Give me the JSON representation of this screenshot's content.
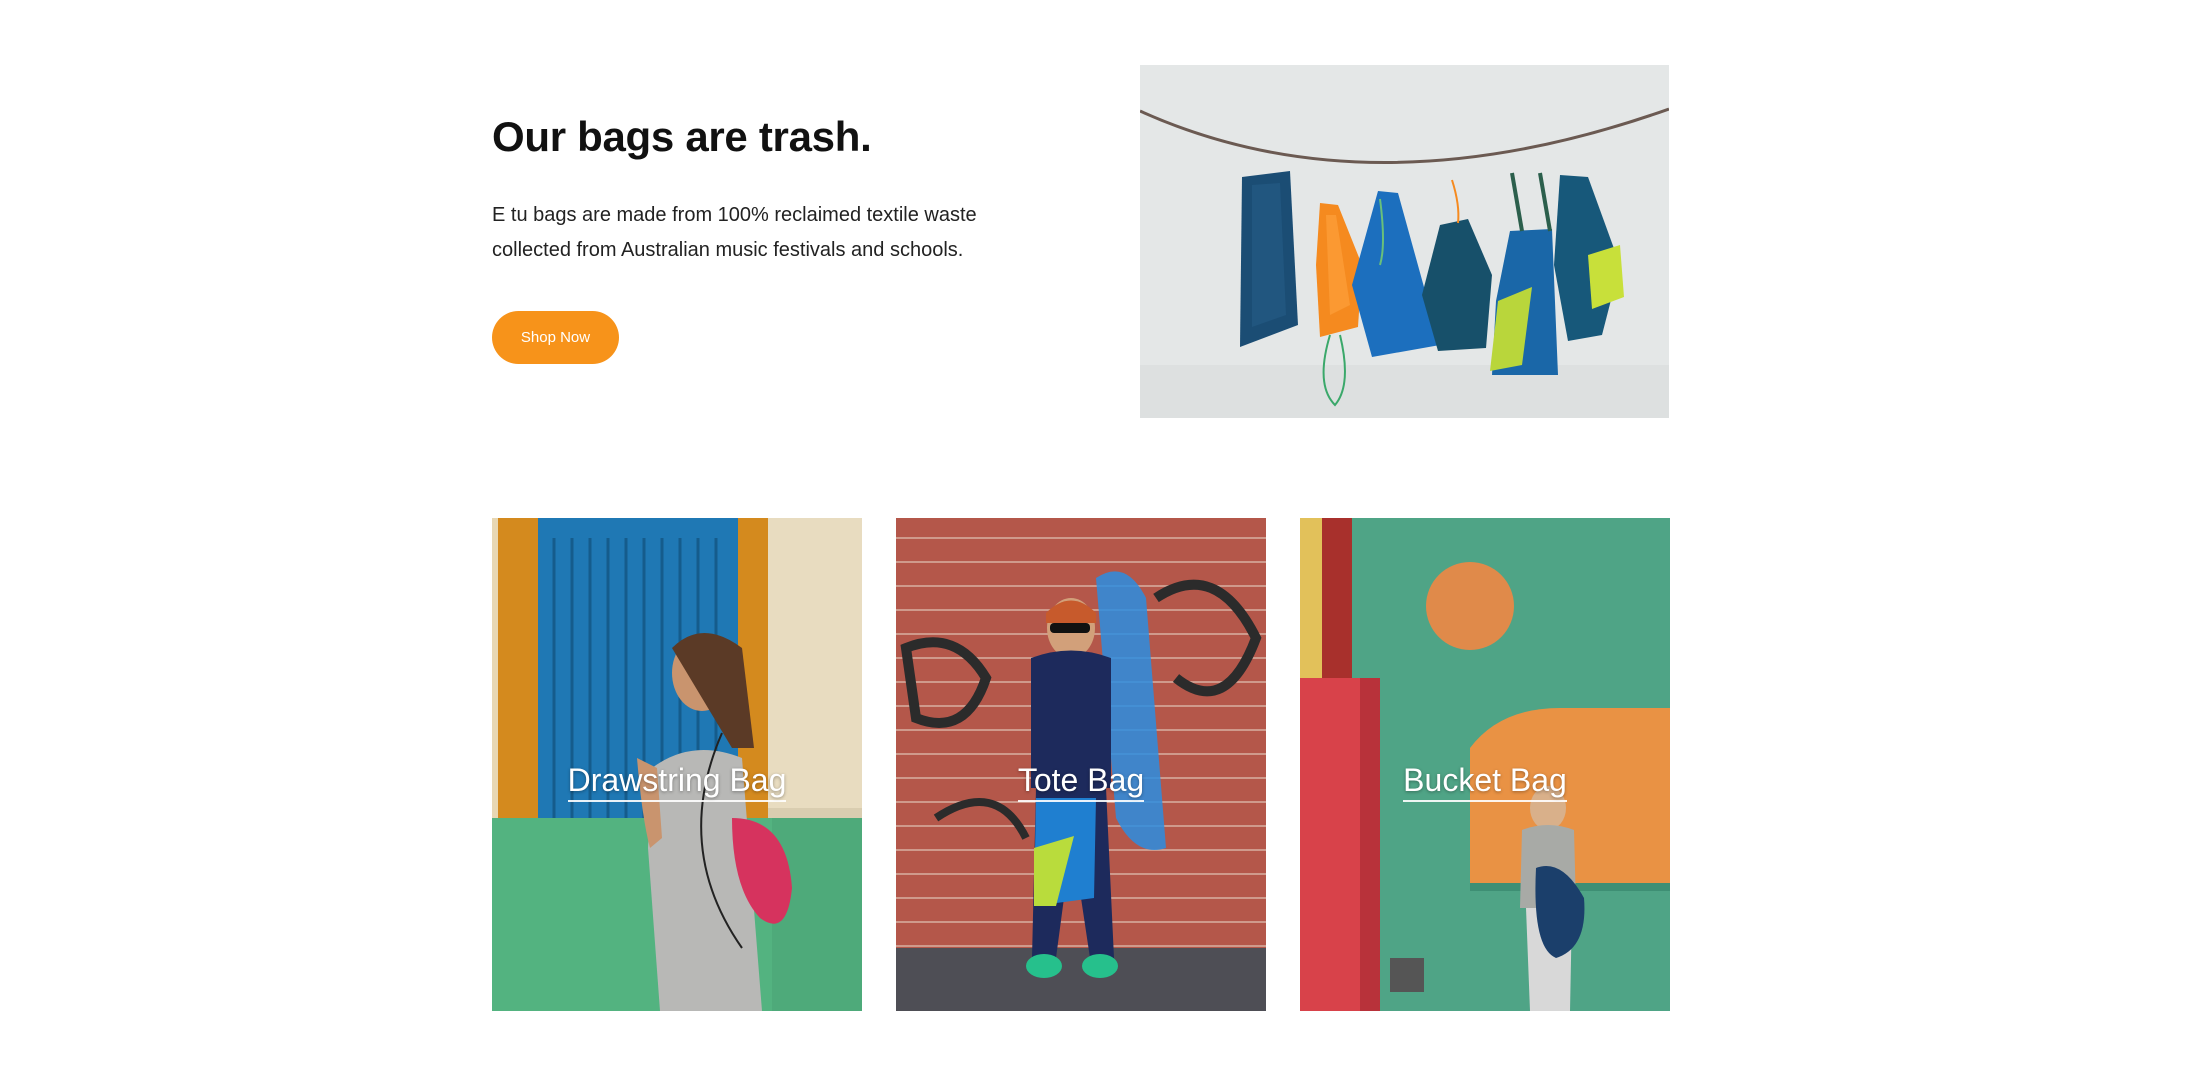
{
  "hero": {
    "title": "Our bags are trash.",
    "description_line1": "E tu bags are made from 100% reclaimed textile waste",
    "description_line2": "collected from Australian music festivals and schools.",
    "button_label": "Shop Now",
    "button_color": "#f7931a"
  },
  "categories": [
    {
      "label": "Drawstring Bag"
    },
    {
      "label": "Tote Bag"
    },
    {
      "label": "Bucket Bag"
    }
  ]
}
